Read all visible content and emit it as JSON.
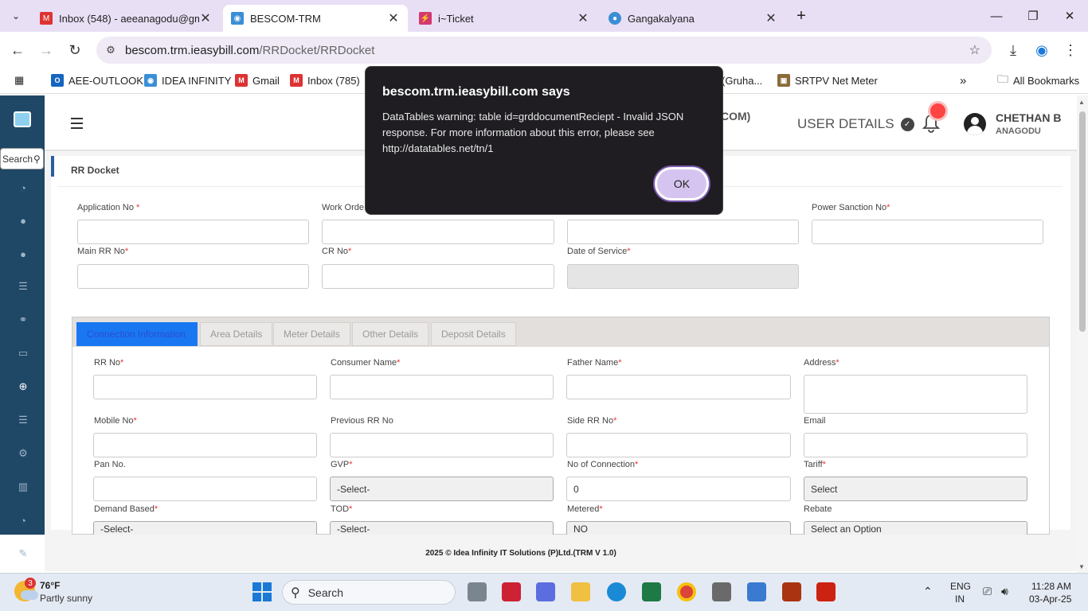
{
  "browser": {
    "tabs": [
      {
        "title": "Inbox (548) - aeeanagodu@gm",
        "icon": "gmail-icon"
      },
      {
        "title": "BESCOM-TRM",
        "icon": "trm-icon"
      },
      {
        "title": "i~Ticket",
        "icon": "ticket-icon"
      },
      {
        "title": "Gangakalyana",
        "icon": "water-drop-icon"
      }
    ],
    "url_domain": "bescom.trm.ieasybill.com",
    "url_path": "/RRDocket/RRDocket",
    "bookmarks": [
      {
        "label": "AEE-OUTLOOK"
      },
      {
        "label": "IDEA INFINITY"
      },
      {
        "label": "Gmail"
      },
      {
        "label": "Inbox (785)"
      },
      {
        "label": "(Gruha..."
      },
      {
        "label": "SRTPV Net Meter"
      }
    ],
    "all_bookmarks": "All Bookmarks"
  },
  "app": {
    "sidebar_search": "Search",
    "header_partial": "COM)",
    "user_details": "USER DETAILS",
    "user_name": "CHETHAN B",
    "user_sub": "ANAGODU",
    "page_title": "RR Docket",
    "fields": {
      "application_no": "Application No",
      "work_order": "Work Orde",
      "power_sanction_no": "Power Sanction No",
      "main_rr_no": "Main RR No",
      "cr_no": "CR No",
      "date_of_service": "Date of Service"
    },
    "tabs": [
      "Connection Information",
      "Area Details",
      "Meter Details",
      "Other Details",
      "Deposit Details"
    ],
    "conn": {
      "rr_no": "RR No",
      "consumer_name": "Consumer Name",
      "father_name": "Father Name",
      "address": "Address",
      "mobile_no": "Mobile No",
      "previous_rr_no": "Previous RR No",
      "side_rr_no": "Side RR No",
      "email": "Email",
      "pan_no": "Pan No.",
      "gvp": "GVP",
      "no_of_connection": "No of Connection",
      "tariff": "Tariff",
      "demand_based": "Demand Based",
      "tod": "TOD",
      "metered": "Metered",
      "rebate": "Rebate",
      "gvp_value": "-Select-",
      "no_of_connection_value": "0",
      "tariff_value": "Select",
      "demand_based_value": "-Select-",
      "tod_value": "-Select-",
      "metered_value": "NO",
      "rebate_value": "Select an Option"
    },
    "footer": "2025 © Idea Infinity IT Solutions (P)Ltd.(TRM V 1.0)"
  },
  "dialog": {
    "title": "bescom.trm.ieasybill.com says",
    "message": "DataTables warning: table id=grddocumentReciept - Invalid JSON response. For more information about this error, please see http://datatables.net/tn/1",
    "ok_label": "OK"
  },
  "taskbar": {
    "weather_temp": "76°F",
    "weather_desc": "Partly sunny",
    "weather_badge": "3",
    "search_label": "Search",
    "lang1": "ENG",
    "lang2": "IN",
    "time": "11:28 AM",
    "date": "03-Apr-25"
  }
}
